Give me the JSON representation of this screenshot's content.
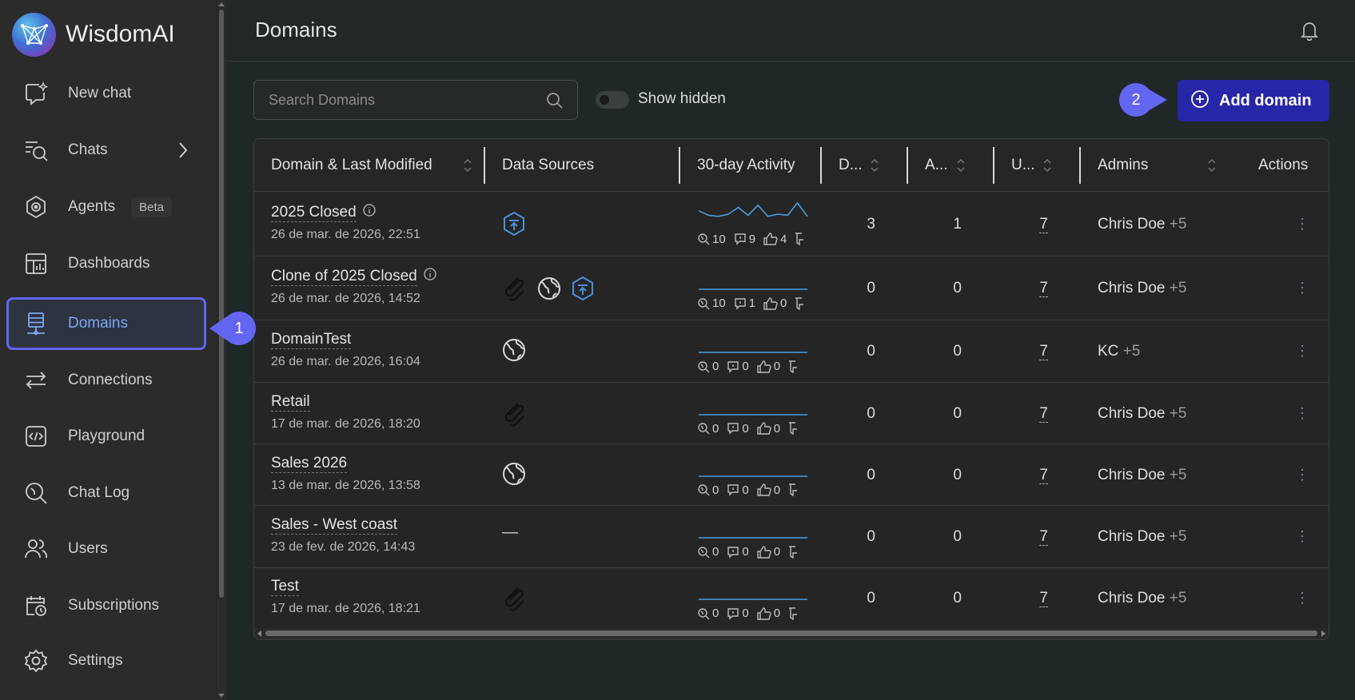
{
  "app": {
    "name": "WisdomAI"
  },
  "sidebar": {
    "items": [
      {
        "label": "New chat",
        "icon": "new-chat-icon"
      },
      {
        "label": "Chats",
        "icon": "chats-icon"
      },
      {
        "label": "Agents",
        "icon": "agents-icon",
        "badge": "Beta"
      },
      {
        "label": "Dashboards",
        "icon": "dashboards-icon"
      },
      {
        "label": "Domains",
        "icon": "domains-icon",
        "active": true
      },
      {
        "label": "Connections",
        "icon": "connections-icon"
      },
      {
        "label": "Playground",
        "icon": "playground-icon"
      },
      {
        "label": "Chat Log",
        "icon": "chat-log-icon"
      },
      {
        "label": "Users",
        "icon": "users-icon"
      },
      {
        "label": "Subscriptions",
        "icon": "subscriptions-icon"
      },
      {
        "label": "Settings",
        "icon": "settings-icon"
      }
    ]
  },
  "callouts": {
    "one": "1",
    "two": "2"
  },
  "header": {
    "title": "Domains"
  },
  "toolbar": {
    "search_placeholder": "Search Domains",
    "show_hidden_label": "Show hidden",
    "show_hidden": false,
    "add_label": "Add domain"
  },
  "table": {
    "columns": {
      "domain": "Domain & Last Modified",
      "sources": "Data Sources",
      "activity": "30-day Activity",
      "d": "D...",
      "a": "A...",
      "u": "U...",
      "admins": "Admins",
      "actions": "Actions"
    },
    "rows": [
      {
        "name": "2025 Closed",
        "info": true,
        "modified": "26 de mar. de 2026, 22:51",
        "sources": [
          "hex-upload-icon"
        ],
        "activity": {
          "queries": "10",
          "comments": "9",
          "likes": "4",
          "dislikes": ""
        },
        "d": "3",
        "a": "1",
        "u": "7",
        "admin": "Chris Doe",
        "admin_more": "+5",
        "sparkline": [
          0.35,
          0.55,
          0.6,
          0.5,
          0.2,
          0.55,
          0.1,
          0.6,
          0.5,
          0.55,
          0.0,
          0.6
        ]
      },
      {
        "name": "Clone of 2025 Closed",
        "info": true,
        "modified": "26 de mar. de 2026, 14:52",
        "sources": [
          "paperclip-icon",
          "globe-icon",
          "hex-upload-icon"
        ],
        "activity": {
          "queries": "10",
          "comments": "1",
          "likes": "0",
          "dislikes": ""
        },
        "d": "0",
        "a": "0",
        "u": "7",
        "admin": "Chris Doe",
        "admin_more": "+5",
        "sparkline": []
      },
      {
        "name": "DomainTest",
        "info": false,
        "modified": "26 de mar. de 2026, 16:04",
        "sources": [
          "globe-icon"
        ],
        "activity": {
          "queries": "0",
          "comments": "0",
          "likes": "0",
          "dislikes": ""
        },
        "d": "0",
        "a": "0",
        "u": "7",
        "admin": "KC",
        "admin_more": "+5",
        "sparkline": []
      },
      {
        "name": "Retail",
        "info": false,
        "modified": "17 de mar. de 2026, 18:20",
        "sources": [
          "paperclip-icon"
        ],
        "activity": {
          "queries": "0",
          "comments": "0",
          "likes": "0",
          "dislikes": ""
        },
        "d": "0",
        "a": "0",
        "u": "7",
        "admin": "Chris Doe",
        "admin_more": "+5",
        "sparkline": []
      },
      {
        "name": "Sales 2026",
        "info": false,
        "modified": "13 de mar. de 2026, 13:58",
        "sources": [
          "globe-icon"
        ],
        "activity": {
          "queries": "0",
          "comments": "0",
          "likes": "0",
          "dislikes": ""
        },
        "d": "0",
        "a": "0",
        "u": "7",
        "admin": "Chris Doe",
        "admin_more": "+5",
        "sparkline": []
      },
      {
        "name": "Sales - West coast",
        "info": false,
        "modified": "23 de fev. de 2026, 14:43",
        "sources": [
          "none"
        ],
        "sources_empty": "—",
        "activity": {
          "queries": "0",
          "comments": "0",
          "likes": "0",
          "dislikes": ""
        },
        "d": "0",
        "a": "0",
        "u": "7",
        "admin": "Chris Doe",
        "admin_more": "+5",
        "sparkline": []
      },
      {
        "name": "Test",
        "info": false,
        "modified": "17 de mar. de 2026, 18:21",
        "sources": [
          "paperclip-icon"
        ],
        "activity": {
          "queries": "0",
          "comments": "0",
          "likes": "0",
          "dislikes": ""
        },
        "d": "0",
        "a": "0",
        "u": "7",
        "admin": "Chris Doe",
        "admin_more": "+5",
        "sparkline": []
      }
    ]
  },
  "colors": {
    "accent": "#6366f1",
    "primary_button": "#2626a8",
    "link_active": "#7aa7f5",
    "sparkline": "#4a9ee0"
  }
}
